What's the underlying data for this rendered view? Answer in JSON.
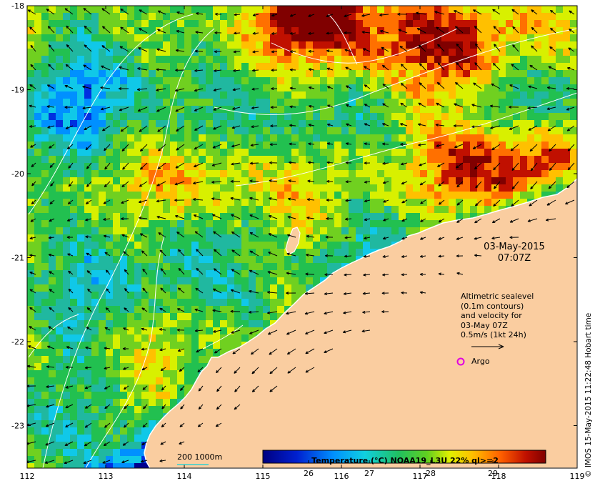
{
  "map": {
    "lon_ticks": [
      "112",
      "113",
      "114",
      "115",
      "116",
      "117",
      "118",
      "119"
    ],
    "lat_ticks": [
      "-18",
      "-19",
      "-20",
      "-21",
      "-22",
      "-23"
    ],
    "date": "03-May-2015",
    "time": "07:07Z",
    "legend_lines": [
      "Altimetric sealevel",
      "(0.1m contours)",
      "and velocity for",
      "03-May 07Z",
      "0.5m/s (1kt 24h)"
    ],
    "argo_label": "Argo",
    "colorbar": {
      "title": "Temperature (°C) NOAA19_L3U 22% ql>=2",
      "ticks": [
        "26",
        "27",
        "28",
        "29"
      ]
    },
    "bathymetry_label": "200  1000m",
    "credit": "© IMOS 15-May-2015 11:22:48 Hobart time",
    "colors": {
      "land": "#FACDA0",
      "argo": "#E000E0",
      "scale_line": "#2FD0D0"
    }
  }
}
